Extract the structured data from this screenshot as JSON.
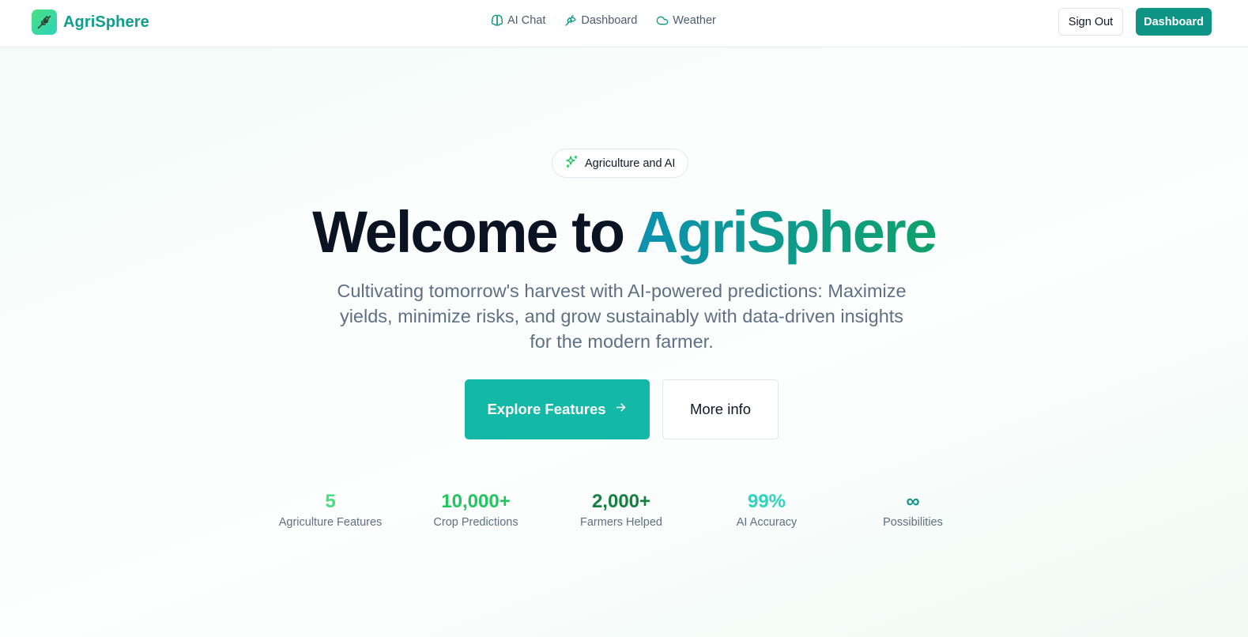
{
  "brand": {
    "name": "AgriSphere",
    "logo_icon": "wheat-icon",
    "color": "#0e9f8c"
  },
  "nav": {
    "links": [
      {
        "label": "AI Chat",
        "icon": "brain-icon"
      },
      {
        "label": "Dashboard",
        "icon": "leaf-icon"
      },
      {
        "label": "Weather",
        "icon": "cloud-icon"
      }
    ],
    "signout_label": "Sign Out",
    "dashboard_label": "Dashboard",
    "accent": "#0e9484"
  },
  "hero": {
    "badge_label": "Agriculture and AI",
    "badge_icon": "sparkles-icon",
    "title_part1": "Welcome to ",
    "title_part2": "AgriSphere",
    "subtitle": "Cultivating tomorrow's harvest with AI-powered predictions: Maximize yields, minimize risks, and grow sustainably with data-driven insights for the modern farmer.",
    "cta_primary": "Explore Features",
    "cta_primary_icon": "arrow-right-icon",
    "cta_secondary": "More info"
  },
  "stats": [
    {
      "value": "5",
      "label": "Agriculture Features",
      "color": "#4ade80"
    },
    {
      "value": "10,000+",
      "label": "Crop Predictions",
      "color": "#22c55e"
    },
    {
      "value": "2,000+",
      "label": "Farmers Helped",
      "color": "#15803d"
    },
    {
      "value": "99%",
      "label": "AI Accuracy",
      "color": "#2dd4bf"
    },
    {
      "value": "∞",
      "label": "Possibilities",
      "color": "#0d9488"
    }
  ]
}
